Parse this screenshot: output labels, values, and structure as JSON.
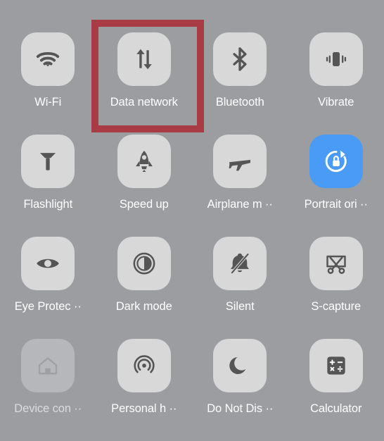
{
  "panel": {
    "name": "Quick settings panel",
    "background_color": "#9c9da1",
    "tile_color": "#d8d8d9",
    "tile_active_color": "#4a9bf5",
    "tile_dimmed_color": "#b6b7ba",
    "label_color": "#ffffff",
    "icon_color": "#555555",
    "columns": 4,
    "rows": 4
  },
  "highlight": {
    "color": "#a83b43",
    "target_label": "Data network",
    "border_width": "10px"
  },
  "tiles": [
    {
      "label": "Wi-Fi",
      "icon": "wifi-icon",
      "state": "off"
    },
    {
      "label": "Data network",
      "icon": "data-network-icon",
      "state": "off"
    },
    {
      "label": "Bluetooth",
      "icon": "bluetooth-icon",
      "state": "off"
    },
    {
      "label": "Vibrate",
      "icon": "vibrate-icon",
      "state": "off"
    },
    {
      "label": "Flashlight",
      "icon": "flashlight-icon",
      "state": "off"
    },
    {
      "label": "Speed up",
      "icon": "rocket-icon",
      "state": "off"
    },
    {
      "label": "Airplane m ··",
      "icon": "airplane-icon",
      "state": "off"
    },
    {
      "label": "Portrait ori ··",
      "icon": "rotation-lock-icon",
      "state": "on"
    },
    {
      "label": "Eye Protec ··",
      "icon": "eye-icon",
      "state": "off"
    },
    {
      "label": "Dark mode",
      "icon": "dark-mode-icon",
      "state": "off"
    },
    {
      "label": "Silent",
      "icon": "bell-slash-icon",
      "state": "off"
    },
    {
      "label": "S-capture",
      "icon": "screen-capture-icon",
      "state": "off"
    },
    {
      "label": "Device con ··",
      "icon": "home-icon",
      "state": "dimmed"
    },
    {
      "label": "Personal h ··",
      "icon": "hotspot-icon",
      "state": "off"
    },
    {
      "label": "Do Not Dis ··",
      "icon": "moon-icon",
      "state": "off"
    },
    {
      "label": "Calculator",
      "icon": "calculator-icon",
      "state": "off"
    }
  ]
}
